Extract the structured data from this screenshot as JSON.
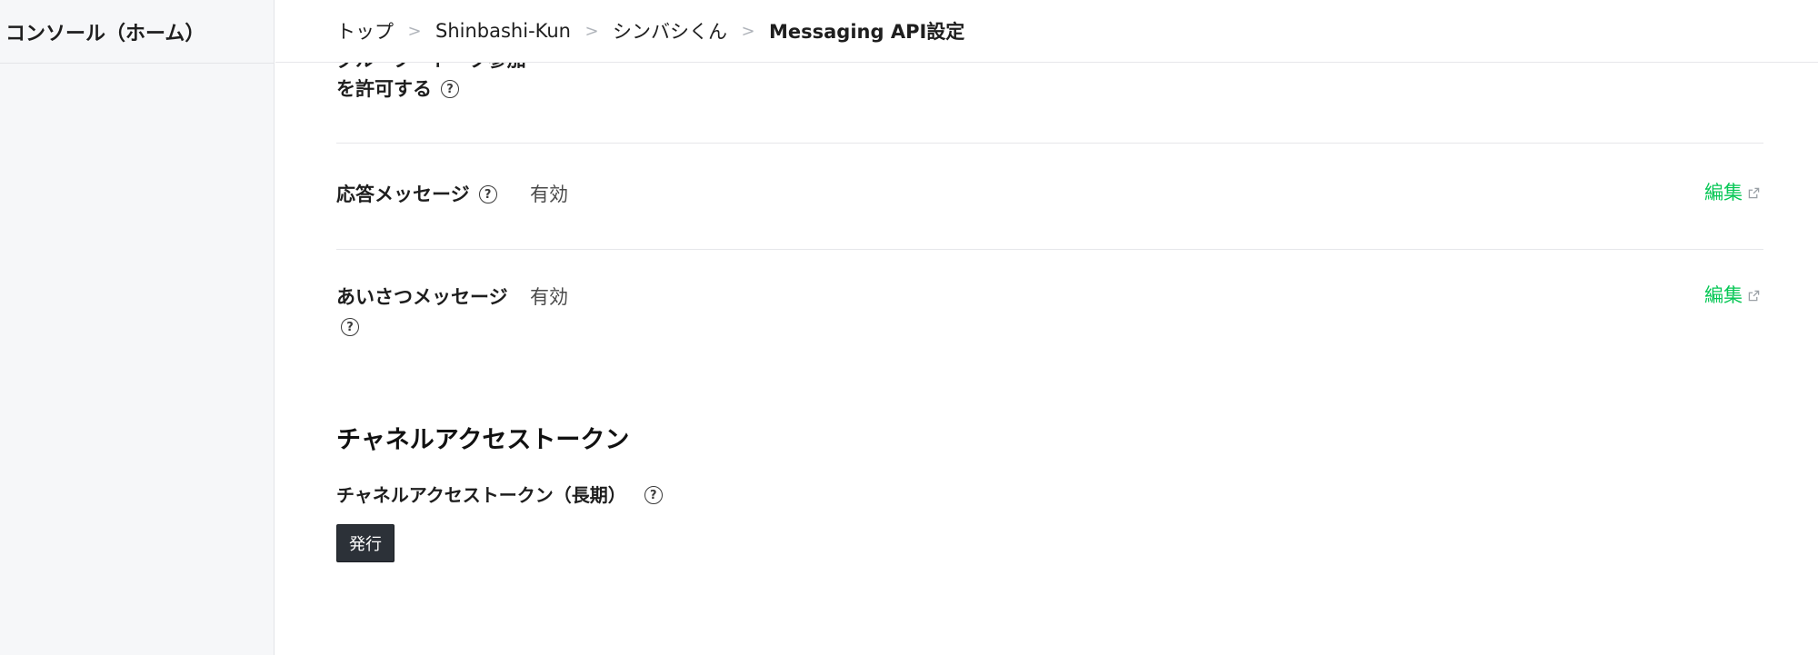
{
  "sidebar": {
    "header_title": "コンソール（ホーム）"
  },
  "breadcrumb": {
    "items": [
      "トップ",
      "Shinbashi-Kun",
      "シンバシくん",
      "Messaging API設定"
    ],
    "separator": ">"
  },
  "settings": {
    "group_join": {
      "label_line1": "グループ・トーク参加",
      "label_line2": "を許可する"
    },
    "auto_reply": {
      "label": "応答メッセージ",
      "value": "有効",
      "edit_label": "編集"
    },
    "greeting": {
      "label": "あいさつメッセージ",
      "value": "有効",
      "edit_label": "編集"
    }
  },
  "channel_access_token": {
    "section_title": "チャネルアクセストークン",
    "long_term_label": "チャネルアクセストークン（長期）",
    "issue_button_label": "発行"
  },
  "icons": {
    "help": "question-circle-icon",
    "external": "external-link-icon",
    "chevron": "chevron-right-icon"
  },
  "colors": {
    "accent_green": "#06c755",
    "button_dark": "#2c3138",
    "sidebar_bg": "#f6f7f9"
  }
}
